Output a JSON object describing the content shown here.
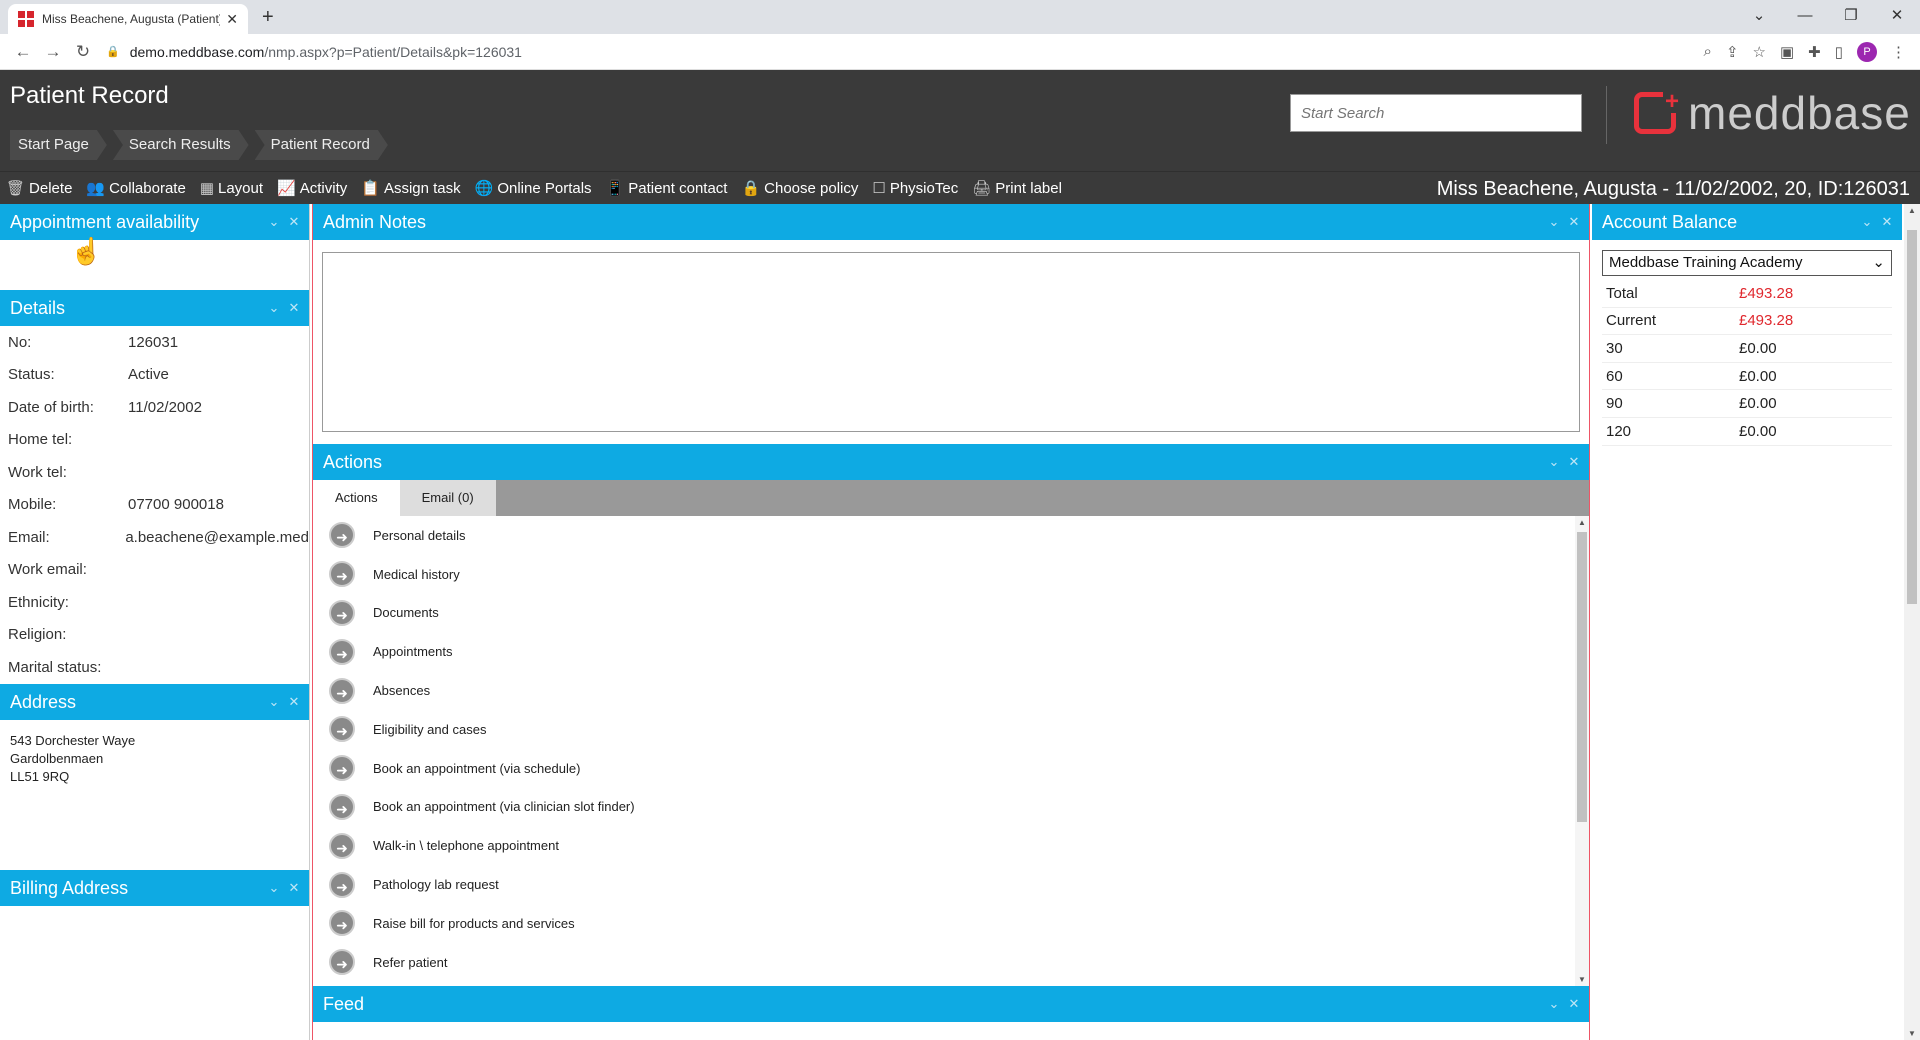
{
  "browser": {
    "tab_title": "Miss Beachene, Augusta (Patient)",
    "url_host": "demo.meddbase.com",
    "url_rest": "/nmp.aspx?p=Patient/Details&pk=126031",
    "profile_initial": "P"
  },
  "header": {
    "title": "Patient Record",
    "breadcrumbs": [
      "Start Page",
      "Search Results",
      "Patient Record"
    ],
    "search_placeholder": "Start Search",
    "logo_text": "meddbase"
  },
  "toolbar": {
    "items": [
      {
        "label": "Delete",
        "icon": "trash-icon"
      },
      {
        "label": "Collaborate",
        "icon": "people-icon"
      },
      {
        "label": "Layout",
        "icon": "grid-icon"
      },
      {
        "label": "Activity",
        "icon": "chart-icon"
      },
      {
        "label": "Assign task",
        "icon": "clipboard-icon"
      },
      {
        "label": "Online Portals",
        "icon": "globe-icon"
      },
      {
        "label": "Patient contact",
        "icon": "phone-icon"
      },
      {
        "label": "Choose policy",
        "icon": "lock-icon"
      },
      {
        "label": "PhysioTec",
        "icon": "square-icon"
      },
      {
        "label": "Print label",
        "icon": "printer-icon"
      }
    ],
    "patient_title": "Miss Beachene, Augusta - 11/02/2002, 20, ID:126031"
  },
  "panels": {
    "appointment_availability": "Appointment availability",
    "details": "Details",
    "address": "Address",
    "billing_address": "Billing Address",
    "admin_notes": "Admin Notes",
    "actions": "Actions",
    "feed": "Feed",
    "account_balance": "Account Balance"
  },
  "details": [
    {
      "k": "No:",
      "v": "126031"
    },
    {
      "k": "Status:",
      "v": "Active"
    },
    {
      "k": "Date of birth:",
      "v": "11/02/2002"
    },
    {
      "k": "Home tel:",
      "v": ""
    },
    {
      "k": "Work tel:",
      "v": ""
    },
    {
      "k": "Mobile:",
      "v": "07700 900018"
    },
    {
      "k": "Email:",
      "v": "a.beachene@example.med"
    },
    {
      "k": "Work email:",
      "v": ""
    },
    {
      "k": "Ethnicity:",
      "v": ""
    },
    {
      "k": "Religion:",
      "v": ""
    },
    {
      "k": "Marital status:",
      "v": ""
    }
  ],
  "address_lines": [
    "543 Dorchester Waye",
    "Gardolbenmaen",
    "LL51 9RQ"
  ],
  "action_tabs": [
    "Actions",
    "Email (0)"
  ],
  "actions": [
    "Personal details",
    "Medical history",
    "Documents",
    "Appointments",
    "Absences",
    "Eligibility and cases",
    "Book an appointment (via schedule)",
    "Book an appointment (via clinician slot finder)",
    "Walk-in \\ telephone appointment",
    "Pathology lab request",
    "Raise bill for products and services",
    "Refer patient"
  ],
  "account": {
    "selected": "Meddbase Training Academy",
    "rows": [
      {
        "k": "Total",
        "v": "£493.28",
        "neg": true
      },
      {
        "k": "Current",
        "v": "£493.28",
        "neg": true
      },
      {
        "k": "30",
        "v": "£0.00",
        "neg": false
      },
      {
        "k": "60",
        "v": "£0.00",
        "neg": false
      },
      {
        "k": "90",
        "v": "£0.00",
        "neg": false
      },
      {
        "k": "120",
        "v": "£0.00",
        "neg": false
      }
    ]
  },
  "colors": {
    "accent": "#0eaae3",
    "header_bg": "#3a3a3a",
    "negative": "#e0282e"
  }
}
